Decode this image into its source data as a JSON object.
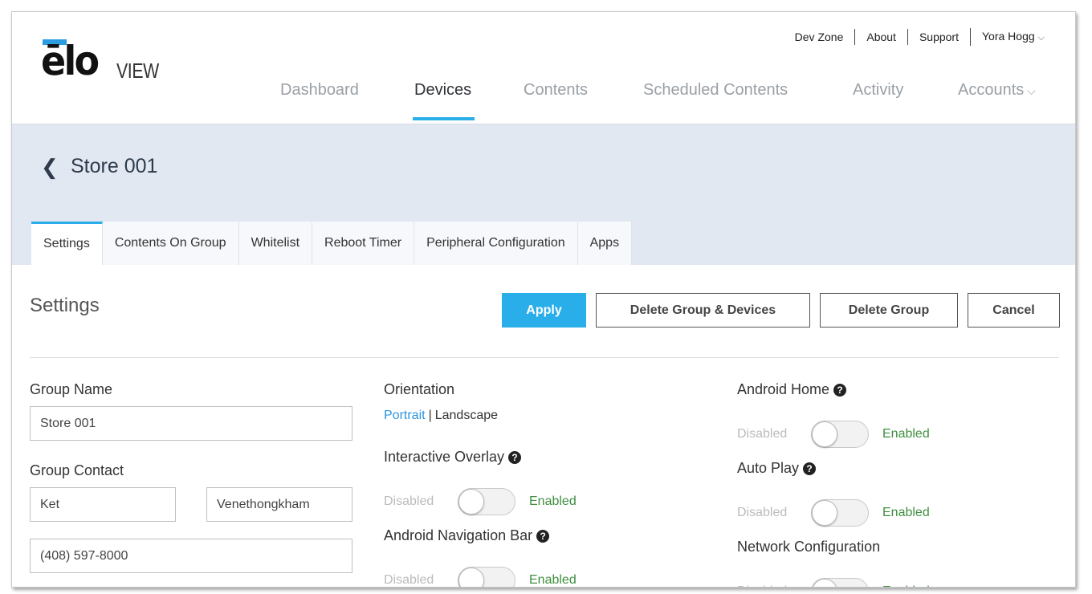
{
  "brand": {
    "logo_main": "ēlo",
    "logo_sub": "VIEW"
  },
  "top_links": [
    "Dev Zone",
    "About",
    "Support",
    "Yora Hogg"
  ],
  "nav": [
    "Dashboard",
    "Devices",
    "Contents",
    "Scheduled Contents",
    "Activity",
    "Accounts"
  ],
  "nav_active": "Devices",
  "page": {
    "back_icon": "chevron-left-icon",
    "title": "Store 001"
  },
  "tabs": [
    "Settings",
    "Contents On Group",
    "Whitelist",
    "Reboot Timer",
    "Peripheral Configuration",
    "Apps"
  ],
  "active_tab": "Settings",
  "settings": {
    "heading": "Settings",
    "buttons": {
      "apply": "Apply",
      "delete_group_devices": "Delete Group & Devices",
      "delete_group": "Delete Group",
      "cancel": "Cancel"
    },
    "group_name": {
      "label": "Group Name",
      "value": "Store 001"
    },
    "group_contact": {
      "label": "Group Contact",
      "first_name": "Ket",
      "last_name": "Venethongkham",
      "phone": "(408) 597-8000"
    },
    "orientation": {
      "label": "Orientation",
      "portrait": "Portrait",
      "separator": "|",
      "landscape": "Landscape"
    },
    "toggles": {
      "disabled_label": "Disabled",
      "enabled_label": "Enabled",
      "interactive_overlay": {
        "label": "Interactive Overlay",
        "enabled": false
      },
      "android_navigation_bar": {
        "label": "Android Navigation Bar",
        "enabled": false
      },
      "android_home": {
        "label": "Android Home",
        "enabled": false
      },
      "auto_play": {
        "label": "Auto Play",
        "enabled": false
      },
      "network_configuration": {
        "label": "Network Configuration",
        "enabled": false
      }
    }
  },
  "colors": {
    "accent": "#2aaeea",
    "band": "#e2e8f1",
    "enabled_text": "#3f8f3f",
    "link": "#2a94dd"
  }
}
